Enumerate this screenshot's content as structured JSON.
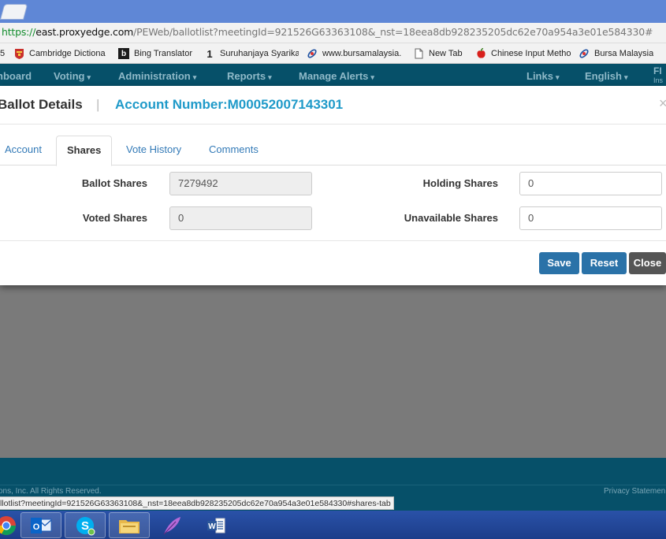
{
  "browser": {
    "url": {
      "proto": "https://",
      "host": "east.proxyedge.com",
      "path": "/PEWeb/ballotlist?meetingId=921526G63363108&_nst=18eea8db928235205dc62e70a954a3e01e584330#"
    },
    "bookmarks": [
      {
        "label": "Cambridge Dictiona",
        "icon": "cambridge-icon"
      },
      {
        "label": "Bing Translator",
        "icon": "bing-icon"
      },
      {
        "label": "Suruhanjaya Syarika",
        "icon": "ssm-icon"
      },
      {
        "label": "www.bursamalaysia.",
        "icon": "bursa-icon"
      },
      {
        "label": "New Tab",
        "icon": "page-icon"
      },
      {
        "label": "Chinese Input Metho",
        "icon": "apple-icon"
      },
      {
        "label": "Bursa Malaysia",
        "icon": "bursa-icon"
      }
    ],
    "bookmark_prefix": "5"
  },
  "nav": {
    "items": [
      {
        "label": "nboard",
        "caret": ""
      },
      {
        "label": "Voting",
        "caret": "▾"
      },
      {
        "label": "Administration",
        "caret": "▾"
      },
      {
        "label": "Reports",
        "caret": "▾"
      },
      {
        "label": "Manage Alerts",
        "caret": "▾"
      },
      {
        "label": "Links",
        "caret": "▾"
      },
      {
        "label": "English",
        "caret": "▾"
      }
    ],
    "fi_top": "FI",
    "fi_bottom": "Ins"
  },
  "modal": {
    "title": "Ballot Details",
    "separator": "|",
    "account": "Account Number:M00052007143301",
    "close_glyph": "×",
    "tabs": [
      {
        "label": "Account",
        "active": false
      },
      {
        "label": "Shares",
        "active": true
      },
      {
        "label": "Vote History",
        "active": false
      },
      {
        "label": "Comments",
        "active": false
      }
    ],
    "fields": {
      "ballot_shares": {
        "label": "Ballot Shares",
        "value": "7279492"
      },
      "voted_shares": {
        "label": "Voted Shares",
        "value": "0"
      },
      "holding_shares": {
        "label": "Holding Shares",
        "value": "0"
      },
      "unavailable_shares": {
        "label": "Unavailable Shares",
        "value": "0"
      }
    },
    "buttons": {
      "save": "Save",
      "reset": "Reset",
      "close": "Close"
    }
  },
  "footer": {
    "copyright": "ons, Inc. All Rights Reserved.",
    "privacy": "Privacy Statemen",
    "status_url": "llotlist?meetingId=921526G63363108&_nst=18eea8db928235205dc62e70a954a3e01e584330#shares-tab"
  },
  "taskbar": {
    "apps": [
      "chrome-icon",
      "outlook-icon",
      "skype-icon",
      "file-explorer-icon",
      "feather-app-icon",
      "word-icon"
    ],
    "word_label": "W"
  },
  "colors": {
    "nav_bg": "#065069",
    "accent": "#1f9ac9",
    "primary_button": "#2a72a8",
    "close_button": "#555555"
  }
}
